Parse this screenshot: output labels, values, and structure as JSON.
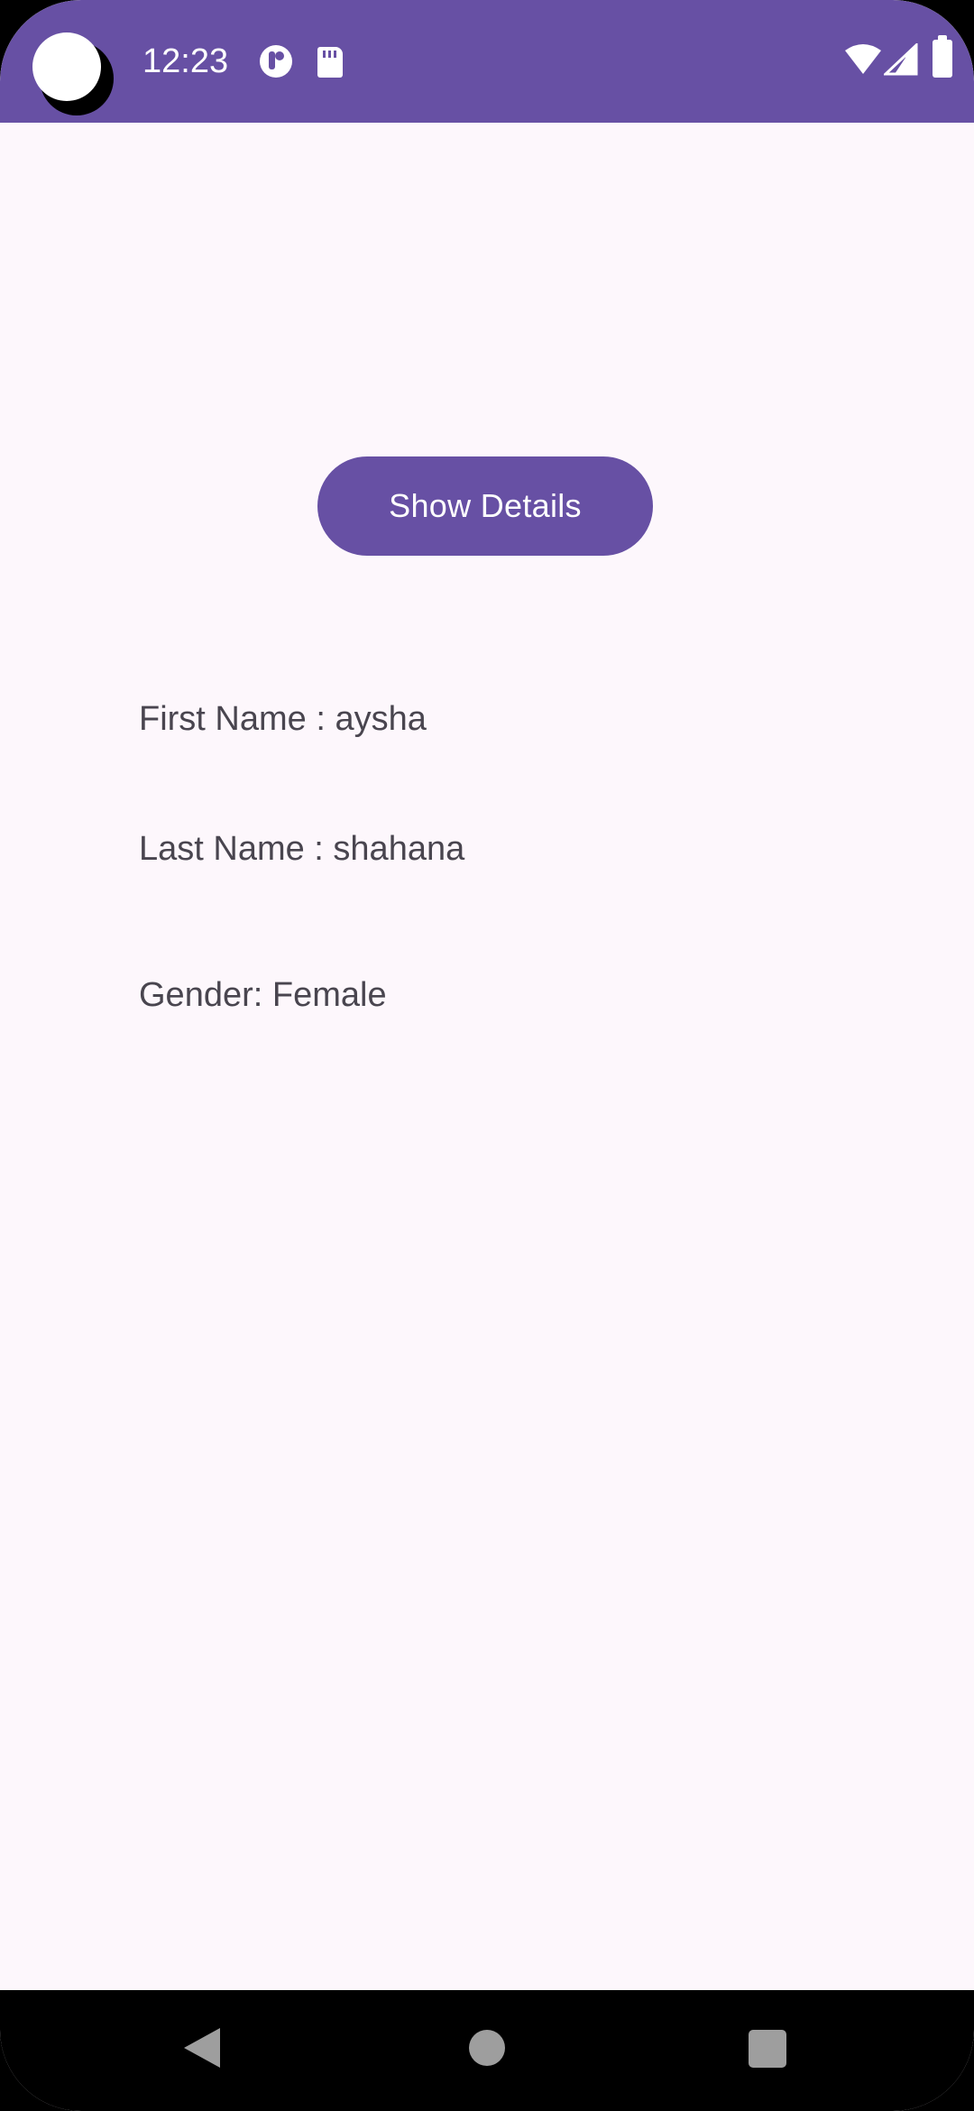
{
  "status_bar": {
    "time": "12:23",
    "icons": [
      "camera-cutout",
      "notification-icon",
      "sd-card-icon",
      "wifi-icon",
      "cell-signal-icon",
      "battery-icon"
    ],
    "background_color": "#6750a4"
  },
  "main": {
    "show_details_label": "Show Details",
    "first_name_text": "First Name : aysha",
    "last_name_text": "Last Name : shahana",
    "gender_text": "Gender: Female",
    "accent_color": "#6750a4",
    "background_color": "#fdf7fc"
  },
  "nav_bar": {
    "buttons": [
      "back",
      "home",
      "recents"
    ]
  }
}
